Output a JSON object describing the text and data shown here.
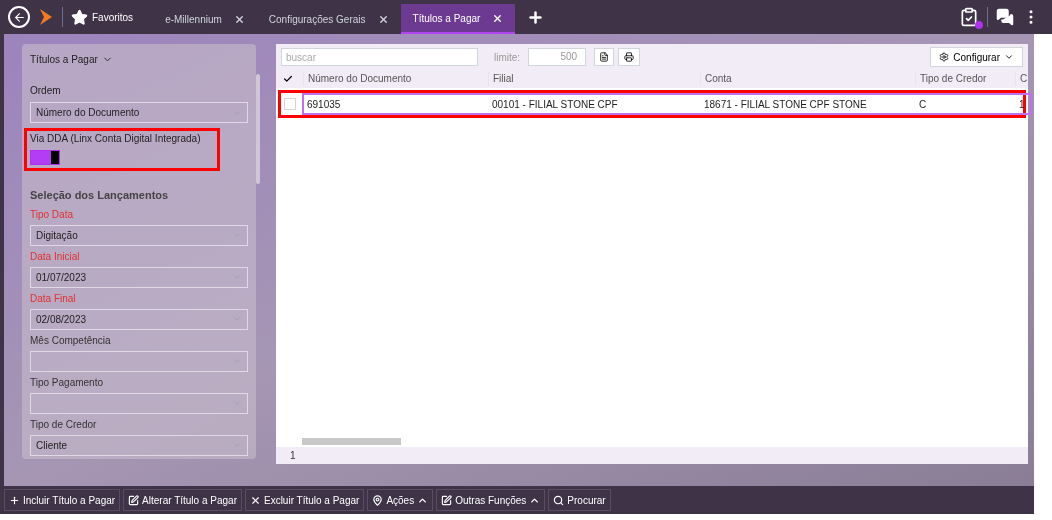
{
  "topbar": {
    "favorites": "Favoritos",
    "tabs": [
      {
        "label": "e-Millennium",
        "selected": false
      },
      {
        "label": "Configurações Gerais",
        "selected": false
      },
      {
        "label": "Títulos a Pagar",
        "selected": true
      }
    ],
    "notification": true
  },
  "sidebar": {
    "title": "Títulos a Pagar",
    "order": {
      "label": "Ordem",
      "value": "Número do Documento"
    },
    "dda": {
      "label": "Via DDA (Linx Conta Digital Integrada)",
      "on": true
    },
    "section": "Seleção dos Lançamentos",
    "fields": [
      {
        "label": "Tipo Data",
        "required": true,
        "value": "Digitação"
      },
      {
        "label": "Data Inicial",
        "required": true,
        "value": "01/07/2023"
      },
      {
        "label": "Data Final",
        "required": true,
        "value": "02/08/2023"
      },
      {
        "label": "Mês Competência",
        "required": false
      },
      {
        "label": "Tipo Pagamento",
        "required": false
      },
      {
        "label": "Tipo de Credor",
        "required": false,
        "value": "Cliente"
      }
    ]
  },
  "grid": {
    "search": {
      "placeholder": "buscar"
    },
    "limit_label": "limite:",
    "limit": "500",
    "configure": "Configurar",
    "columns": [
      "Número do Documento",
      "Filial",
      "Conta",
      "Tipo de Credor",
      "C"
    ],
    "rows": [
      {
        "checked": false,
        "selected": true,
        "cells": [
          "691035",
          "00101 - FILIAL STONE CPF",
          "18671 - FILIAL STONE CPF STONE",
          "C",
          "1"
        ]
      }
    ],
    "footer": "1"
  },
  "actions": [
    {
      "label": "Incluir Título a Pagar",
      "kind": "add",
      "menu": false
    },
    {
      "label": "Alterar Título a Pagar",
      "kind": "edit",
      "menu": false
    },
    {
      "label": "Excluir Título a Pagar",
      "kind": "delete",
      "menu": false
    },
    {
      "label": "Ações",
      "kind": "pin",
      "menu": true
    },
    {
      "label": "Outras Funções",
      "kind": "edit",
      "menu": true
    },
    {
      "label": "Procurar",
      "kind": "search",
      "menu": false
    }
  ]
}
